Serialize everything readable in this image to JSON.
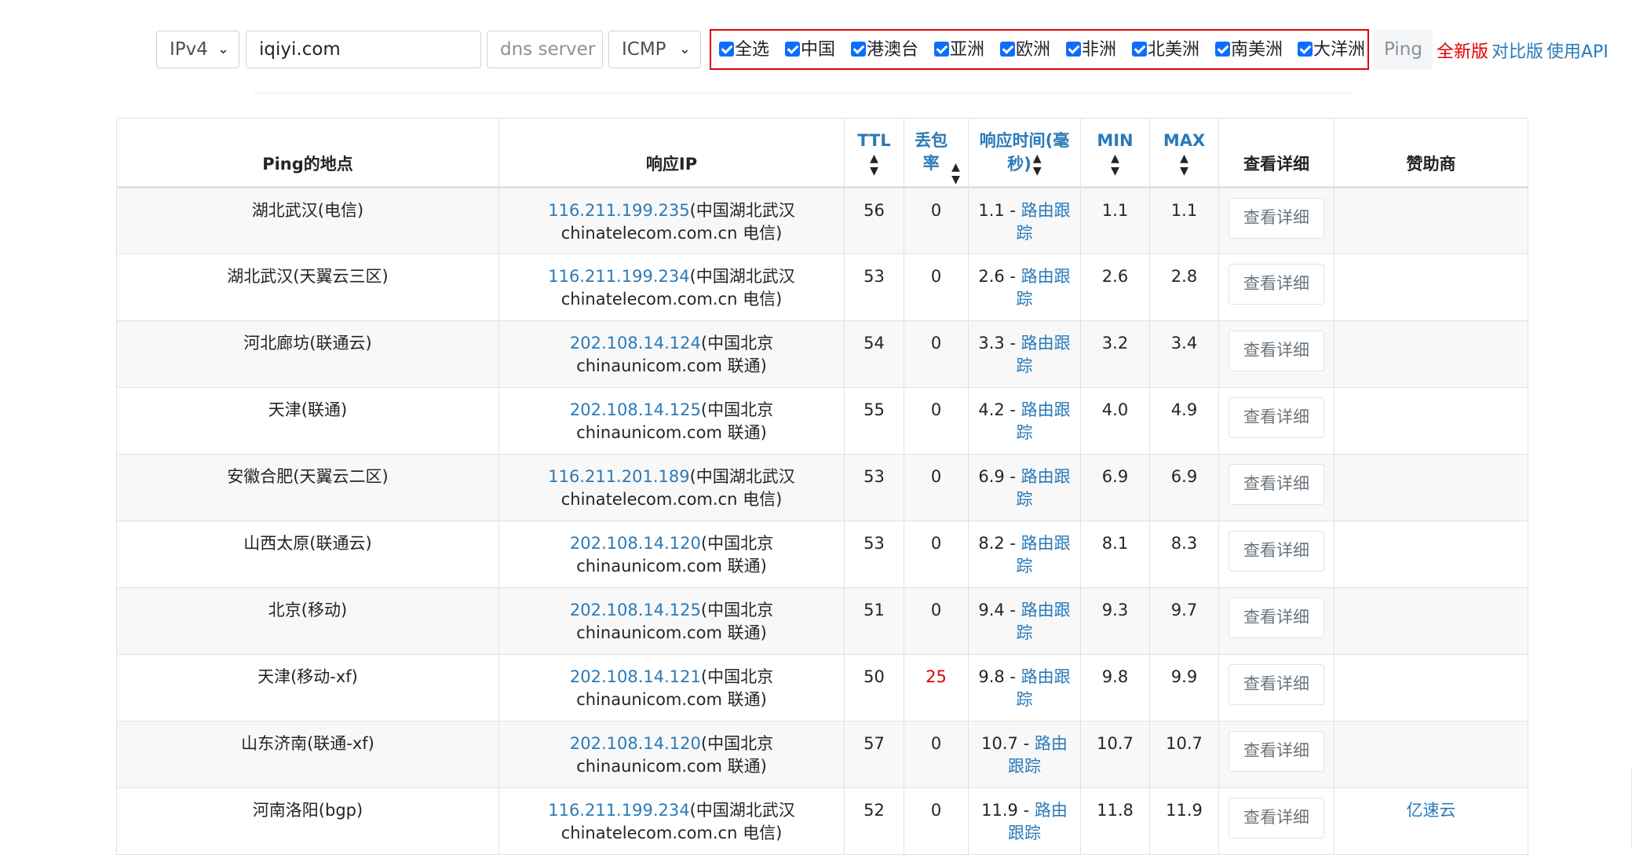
{
  "toolbar": {
    "ip_version": "IPv4",
    "host": "iqiyi.com",
    "dns_placeholder": "dns server",
    "protocol": "ICMP",
    "regions": [
      "全选",
      "中国",
      "港澳台",
      "亚洲",
      "欧洲",
      "非洲",
      "北美洲",
      "南美洲",
      "大洋洲"
    ],
    "ping_label": "Ping",
    "link_new": "全新版",
    "link_compare": "对比版",
    "link_api": "使用API"
  },
  "colors": {
    "accent": "#2a7ab8",
    "alert": "#e00000",
    "checkbox": "#0d6efd"
  },
  "table": {
    "headers": {
      "location": "Ping的地点",
      "ip": "响应IP",
      "ttl": "TTL",
      "loss": "丢包率",
      "time": "响应时间(毫秒)",
      "min": "MIN",
      "max": "MAX",
      "details": "查看详细",
      "sponsor": "赞助商"
    },
    "sort_icon": "sort-updown-icon",
    "detail_button_label": "查看详细",
    "rows": [
      {
        "location": "湖北武汉(电信)",
        "ip": "116.211.199.235",
        "ip_info_1": "(中国湖北武汉",
        "ip_info_2": "chinatelecom.com.cn 电信)",
        "ttl": "56",
        "loss": "0",
        "time": "1.1 - ",
        "trace": "路由跟踪",
        "min": "1.1",
        "max": "1.1",
        "sponsor": ""
      },
      {
        "location": "湖北武汉(天翼云三区)",
        "ip": "116.211.199.234",
        "ip_info_1": "(中国湖北武汉",
        "ip_info_2": "chinatelecom.com.cn 电信)",
        "ttl": "53",
        "loss": "0",
        "time": "2.6 - ",
        "trace": "路由跟踪",
        "min": "2.6",
        "max": "2.8",
        "sponsor": ""
      },
      {
        "location": "河北廊坊(联通云)",
        "ip": "202.108.14.124",
        "ip_info_1": "(中国北京",
        "ip_info_2": "chinaunicom.com 联通)",
        "ttl": "54",
        "loss": "0",
        "time": "3.3 - ",
        "trace": "路由跟踪",
        "min": "3.2",
        "max": "3.4",
        "sponsor": ""
      },
      {
        "location": "天津(联通)",
        "ip": "202.108.14.125",
        "ip_info_1": "(中国北京",
        "ip_info_2": "chinaunicom.com 联通)",
        "ttl": "55",
        "loss": "0",
        "time": "4.2 - ",
        "trace": "路由跟踪",
        "min": "4.0",
        "max": "4.9",
        "sponsor": ""
      },
      {
        "location": "安徽合肥(天翼云二区)",
        "ip": "116.211.201.189",
        "ip_info_1": "(中国湖北武汉",
        "ip_info_2": "chinatelecom.com.cn 电信)",
        "ttl": "53",
        "loss": "0",
        "time": "6.9 - ",
        "trace": "路由跟踪",
        "min": "6.9",
        "max": "6.9",
        "sponsor": ""
      },
      {
        "location": "山西太原(联通云)",
        "ip": "202.108.14.120",
        "ip_info_1": "(中国北京",
        "ip_info_2": "chinaunicom.com 联通)",
        "ttl": "53",
        "loss": "0",
        "time": "8.2 - ",
        "trace": "路由跟踪",
        "min": "8.1",
        "max": "8.3",
        "sponsor": ""
      },
      {
        "location": "北京(移动)",
        "ip": "202.108.14.125",
        "ip_info_1": "(中国北京",
        "ip_info_2": "chinaunicom.com 联通)",
        "ttl": "51",
        "loss": "0",
        "time": "9.4 - ",
        "trace": "路由跟踪",
        "min": "9.3",
        "max": "9.7",
        "sponsor": ""
      },
      {
        "location": "天津(移动-xf)",
        "ip": "202.108.14.121",
        "ip_info_1": "(中国北京",
        "ip_info_2": "chinaunicom.com 联通)",
        "ttl": "50",
        "loss": "25",
        "time": "9.8 - ",
        "trace": "路由跟踪",
        "min": "9.8",
        "max": "9.9",
        "sponsor": ""
      },
      {
        "location": "山东济南(联通-xf)",
        "ip": "202.108.14.120",
        "ip_info_1": "(中国北京",
        "ip_info_2": "chinaunicom.com 联通)",
        "ttl": "57",
        "loss": "0",
        "time": "10.7 - ",
        "trace": "路由跟踪",
        "min": "10.7",
        "max": "10.7",
        "sponsor": ""
      },
      {
        "location": "河南洛阳(bgp)",
        "ip": "116.211.199.234",
        "ip_info_1": "(中国湖北武汉",
        "ip_info_2": "chinatelecom.com.cn 电信)",
        "ttl": "52",
        "loss": "0",
        "time": "11.9 - ",
        "trace": "路由跟踪",
        "min": "11.8",
        "max": "11.9",
        "sponsor": "亿速云"
      }
    ]
  }
}
